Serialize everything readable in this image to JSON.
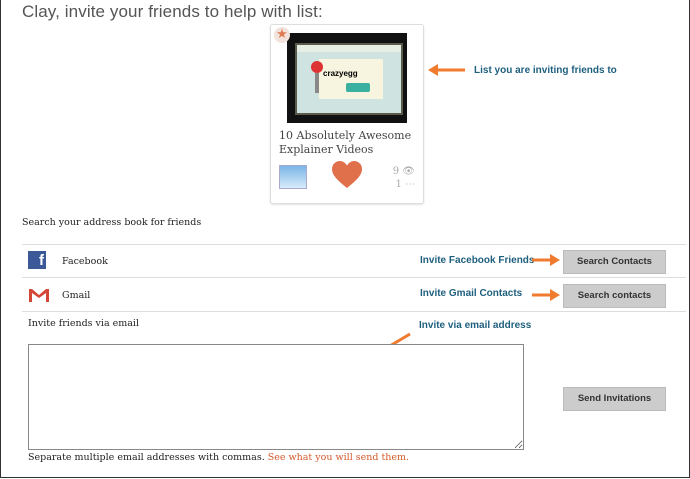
{
  "header": {
    "title": "Clay, invite your friends to help with list:"
  },
  "card": {
    "video_logo_text": "crazyegg",
    "title": "10 Absolutely Awesome Explainer Videos",
    "views": "9",
    "comments": "1",
    "star_color": "#e07a52",
    "heart_color": "#e0704b"
  },
  "annotations": {
    "list": "List you are inviting friends to",
    "facebook": "Invite Facebook Friends",
    "gmail": "Invite Gmail Contacts",
    "email": "Invite via email address"
  },
  "address_book": {
    "heading": "Search your address book for friends",
    "facebook": {
      "label": "Facebook",
      "button": "Search Contacts"
    },
    "gmail": {
      "label": "Gmail",
      "button": "Search contacts"
    }
  },
  "email_invite": {
    "label": "Invite friends via email",
    "textarea_value": "",
    "send_button": "Send Invitations",
    "note": "Separate multiple email addresses with commas.",
    "note_link": "See what you will send them."
  },
  "colors": {
    "arrow": "#f07b2e",
    "annotation": "#1e5f7e",
    "link": "#d35a2a"
  }
}
